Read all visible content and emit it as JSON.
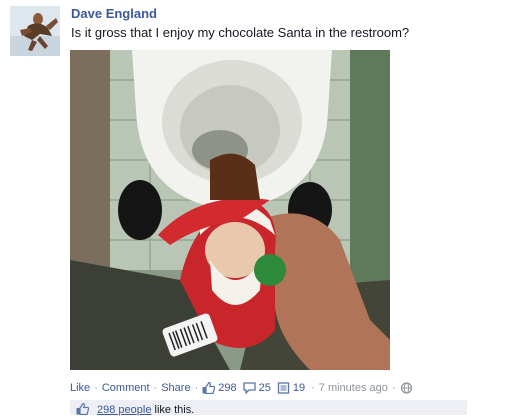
{
  "post": {
    "author": "Dave England",
    "status_text": "Is it gross that I enjoy my chocolate Santa in the restroom?",
    "actions": {
      "like": "Like",
      "comment": "Comment",
      "share": "Share",
      "like_count": "298",
      "comment_count": "25",
      "share_count": "19",
      "timestamp": "7 minutes ago",
      "separator": "·"
    },
    "likes_summary": {
      "link_text": "298 people",
      "rest_text": " like this."
    },
    "icons": [
      "avatar",
      "thumbs-up-icon",
      "comment-icon",
      "share-icon",
      "globe-icon"
    ]
  }
}
